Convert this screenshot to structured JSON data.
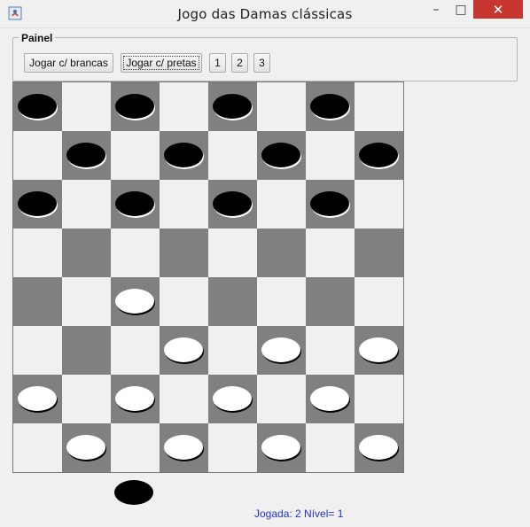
{
  "window": {
    "title": "Jogo das Damas clássicas",
    "controls": [
      "–",
      "□",
      "✕"
    ],
    "colors": {
      "close": "#c7372f"
    }
  },
  "panel": {
    "legend": "Painel",
    "buttons": [
      {
        "label": "Jogar c/ brancas"
      },
      {
        "label": "Jogar c/ pretas"
      },
      {
        "label": "1"
      },
      {
        "label": "2"
      },
      {
        "label": "3"
      }
    ]
  },
  "board": {
    "size": 8,
    "colors": {
      "dark": "#808080",
      "light": "#f0f0f0",
      "black_piece": "#000000",
      "white_piece": "#ffffff"
    },
    "rows": [
      [
        "b",
        "",
        "b",
        "",
        "b",
        "",
        "b",
        ""
      ],
      [
        "",
        "b",
        "",
        "b",
        "",
        "b",
        "",
        "b"
      ],
      [
        "b",
        "",
        "b",
        "",
        "b",
        "",
        "b",
        ""
      ],
      [
        "",
        "",
        "",
        "",
        "",
        "",
        "",
        ""
      ],
      [
        "",
        "",
        "w",
        "",
        "",
        "",
        "",
        ""
      ],
      [
        "",
        "",
        "",
        "w",
        "",
        "w",
        "",
        "w"
      ],
      [
        "w",
        "",
        "w",
        "",
        "w",
        "",
        "w",
        ""
      ],
      [
        "",
        "w",
        "",
        "w",
        "",
        "w",
        "",
        "w"
      ]
    ]
  },
  "turn_indicator": "black",
  "status": "Jogada: 2 Nível= 1"
}
